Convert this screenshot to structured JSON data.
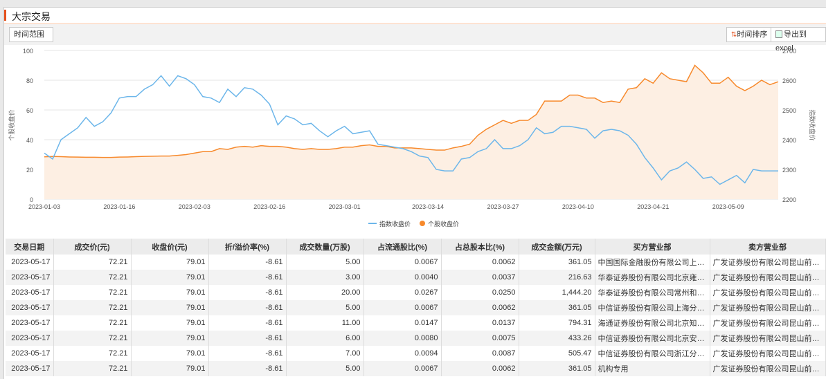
{
  "title": "大宗交易",
  "toolbar": {
    "range_label": "时间范围",
    "sort_label": "时间排序",
    "export_label": "导出到excel",
    "sort_icon": "sort-arrows-icon",
    "export_icon": "excel-icon"
  },
  "chart_data": {
    "type": "line",
    "title": "",
    "colors": {
      "index": "#6cb6ea",
      "stock": "#f7892b",
      "stock_fill": "#fdefe3"
    },
    "x_ticks": [
      {
        "i": 0,
        "label": "2023-01-03"
      },
      {
        "i": 9,
        "label": "2023-01-16"
      },
      {
        "i": 18,
        "label": "2023-02-03"
      },
      {
        "i": 27,
        "label": "2023-02-16"
      },
      {
        "i": 36,
        "label": "2023-03-01"
      },
      {
        "i": 46,
        "label": "2023-03-14"
      },
      {
        "i": 55,
        "label": "2023-03-27"
      },
      {
        "i": 64,
        "label": "2023-04-10"
      },
      {
        "i": 73,
        "label": "2023-04-21"
      },
      {
        "i": 82,
        "label": "2023-05-09"
      }
    ],
    "ylabel_left": "个股收盘价",
    "ylim_left": [
      0,
      100
    ],
    "yticks_left": [
      "0",
      "20",
      "40",
      "60",
      "80",
      "100"
    ],
    "ylabel_right": "指数收盘价",
    "ylim_right": [
      2200,
      2700
    ],
    "yticks_right": [
      "2200",
      "2300",
      "2400",
      "2500",
      "2600",
      "2700"
    ],
    "legend": [
      "指数收盘价",
      "个股收盘价"
    ],
    "legend_position": "bottom-center",
    "series": [
      {
        "name": "指数收盘价",
        "axis": "right",
        "values": [
          2355,
          2335,
          2400,
          2420,
          2440,
          2475,
          2445,
          2460,
          2490,
          2540,
          2545,
          2545,
          2570,
          2585,
          2615,
          2580,
          2615,
          2605,
          2585,
          2545,
          2540,
          2525,
          2570,
          2545,
          2575,
          2570,
          2550,
          2520,
          2450,
          2480,
          2470,
          2450,
          2455,
          2430,
          2410,
          2430,
          2445,
          2420,
          2425,
          2430,
          2385,
          2380,
          2375,
          2370,
          2360,
          2345,
          2340,
          2300,
          2295,
          2295,
          2335,
          2340,
          2360,
          2370,
          2400,
          2370,
          2370,
          2380,
          2400,
          2440,
          2420,
          2425,
          2445,
          2445,
          2440,
          2435,
          2405,
          2430,
          2435,
          2430,
          2415,
          2385,
          2340,
          2305,
          2265,
          2295,
          2305,
          2325,
          2300,
          2270,
          2275,
          2250,
          2265,
          2280,
          2255,
          2300,
          2295,
          2295,
          2295
        ]
      },
      {
        "name": "个股收盘价",
        "axis": "left",
        "values": [
          28.5,
          28.7,
          28.6,
          28.4,
          28.3,
          28.2,
          28.2,
          28.1,
          28.1,
          28.3,
          28.4,
          28.6,
          28.8,
          28.9,
          29,
          29,
          29.5,
          30,
          31,
          32,
          32,
          34,
          33.5,
          35,
          35.5,
          35,
          36,
          35.5,
          35.5,
          35,
          34,
          33.5,
          34,
          33.5,
          33.5,
          34,
          35,
          35,
          36,
          36.5,
          35.5,
          35.5,
          34.5,
          34.5,
          34.5,
          34,
          33.5,
          33,
          33,
          34.5,
          35.5,
          37,
          43,
          47,
          50,
          53,
          51,
          53,
          53,
          57,
          66,
          66,
          66,
          70,
          70,
          68,
          68,
          65,
          66,
          65,
          74,
          75,
          81,
          78,
          85,
          81,
          80,
          79,
          90,
          85,
          78,
          78,
          82,
          76,
          73,
          76,
          80,
          77,
          79
        ]
      }
    ]
  },
  "table": {
    "headers": [
      "交易日期",
      "成交价(元)",
      "收盘价(元)",
      "折/溢价率(%)",
      "成交数量(万股)",
      "占流通股比(%)",
      "占总股本比(%)",
      "成交金额(万元)",
      "买方营业部",
      "卖方营业部"
    ],
    "rows": [
      [
        "2023-05-17",
        "72.21",
        "79.01",
        "-8.61",
        "5.00",
        "0.0067",
        "0.0062",
        "361.05",
        "中国国际金融股份有限公司上海分…",
        "广发证券股份有限公司昆山前进东…"
      ],
      [
        "2023-05-17",
        "72.21",
        "79.01",
        "-8.61",
        "3.00",
        "0.0040",
        "0.0037",
        "216.63",
        "华泰证券股份有限公司北京雍和宫…",
        "广发证券股份有限公司昆山前进东…"
      ],
      [
        "2023-05-17",
        "72.21",
        "79.01",
        "-8.61",
        "20.00",
        "0.0267",
        "0.0250",
        "1,444.20",
        "华泰证券股份有限公司常州和平北…",
        "广发证券股份有限公司昆山前进东…"
      ],
      [
        "2023-05-17",
        "72.21",
        "79.01",
        "-8.61",
        "5.00",
        "0.0067",
        "0.0062",
        "361.05",
        "中信证券股份有限公司上海分公司",
        "广发证券股份有限公司昆山前进东…"
      ],
      [
        "2023-05-17",
        "72.21",
        "79.01",
        "-8.61",
        "11.00",
        "0.0147",
        "0.0137",
        "794.31",
        "海通证券股份有限公司北京知春路…",
        "广发证券股份有限公司昆山前进东…"
      ],
      [
        "2023-05-17",
        "72.21",
        "79.01",
        "-8.61",
        "6.00",
        "0.0080",
        "0.0075",
        "433.26",
        "中信证券股份有限公司北京安外大…",
        "广发证券股份有限公司昆山前进东…"
      ],
      [
        "2023-05-17",
        "72.21",
        "79.01",
        "-8.61",
        "7.00",
        "0.0094",
        "0.0087",
        "505.47",
        "中信证券股份有限公司浙江分公司",
        "广发证券股份有限公司昆山前进东…"
      ],
      [
        "2023-05-17",
        "72.21",
        "79.01",
        "-8.61",
        "5.00",
        "0.0067",
        "0.0062",
        "361.05",
        "机构专用",
        "广发证券股份有限公司昆山前进东…"
      ]
    ]
  }
}
